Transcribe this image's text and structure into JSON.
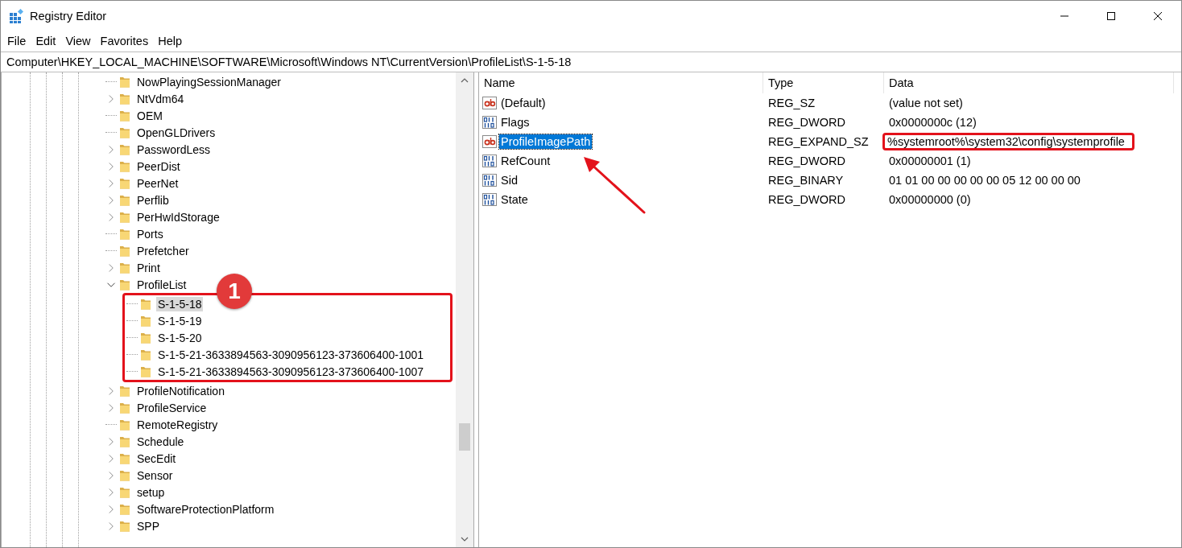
{
  "window": {
    "title": "Registry Editor"
  },
  "menu": [
    "File",
    "Edit",
    "View",
    "Favorites",
    "Help"
  ],
  "address": "Computer\\HKEY_LOCAL_MACHINE\\SOFTWARE\\Microsoft\\Windows NT\\CurrentVersion\\ProfileList\\S-1-5-18",
  "tree": {
    "items": [
      {
        "label": "NowPlayingSessionManager",
        "expandable": false,
        "selected": false
      },
      {
        "label": "NtVdm64",
        "expandable": true,
        "selected": false
      },
      {
        "label": "OEM",
        "expandable": false,
        "selected": false
      },
      {
        "label": "OpenGLDrivers",
        "expandable": false,
        "selected": false
      },
      {
        "label": "PasswordLess",
        "expandable": true,
        "selected": false
      },
      {
        "label": "PeerDist",
        "expandable": true,
        "selected": false
      },
      {
        "label": "PeerNet",
        "expandable": true,
        "selected": false
      },
      {
        "label": "Perflib",
        "expandable": true,
        "selected": false
      },
      {
        "label": "PerHwIdStorage",
        "expandable": true,
        "selected": false
      },
      {
        "label": "Ports",
        "expandable": false,
        "selected": false
      },
      {
        "label": "Prefetcher",
        "expandable": false,
        "selected": false
      },
      {
        "label": "Print",
        "expandable": true,
        "selected": false
      },
      {
        "label": "ProfileList",
        "expandable": true,
        "expanded": true,
        "selected": false,
        "children_highlighted": true,
        "children": [
          {
            "label": "S-1-5-18",
            "expandable": false,
            "selected": true
          },
          {
            "label": "S-1-5-19",
            "expandable": false,
            "selected": false
          },
          {
            "label": "S-1-5-20",
            "expandable": false,
            "selected": false
          },
          {
            "label": "S-1-5-21-3633894563-3090956123-373606400-1001",
            "expandable": false,
            "selected": false
          },
          {
            "label": "S-1-5-21-3633894563-3090956123-373606400-1007",
            "expandable": false,
            "selected": false
          }
        ]
      },
      {
        "label": "ProfileNotification",
        "expandable": true,
        "selected": false
      },
      {
        "label": "ProfileService",
        "expandable": true,
        "selected": false
      },
      {
        "label": "RemoteRegistry",
        "expandable": false,
        "selected": false
      },
      {
        "label": "Schedule",
        "expandable": true,
        "selected": false
      },
      {
        "label": "SecEdit",
        "expandable": true,
        "selected": false
      },
      {
        "label": "Sensor",
        "expandable": true,
        "selected": false
      },
      {
        "label": "setup",
        "expandable": true,
        "selected": false
      },
      {
        "label": "SoftwareProtectionPlatform",
        "expandable": true,
        "selected": false
      },
      {
        "label": "SPP",
        "expandable": true,
        "selected": false
      }
    ]
  },
  "values": {
    "columns": [
      "Name",
      "Type",
      "Data"
    ],
    "rows": [
      {
        "kind": "string",
        "name": "(Default)",
        "type": "REG_SZ",
        "data": "(value not set)",
        "selected": false,
        "data_highlighted": false
      },
      {
        "kind": "binary",
        "name": "Flags",
        "type": "REG_DWORD",
        "data": "0x0000000c (12)",
        "selected": false,
        "data_highlighted": false
      },
      {
        "kind": "string",
        "name": "ProfileImagePath",
        "type": "REG_EXPAND_SZ",
        "data": "%systemroot%\\system32\\config\\systemprofile",
        "selected": true,
        "data_highlighted": true
      },
      {
        "kind": "binary",
        "name": "RefCount",
        "type": "REG_DWORD",
        "data": "0x00000001 (1)",
        "selected": false,
        "data_highlighted": false
      },
      {
        "kind": "binary",
        "name": "Sid",
        "type": "REG_BINARY",
        "data": "01 01 00 00 00 00 00 05 12 00 00 00",
        "selected": false,
        "data_highlighted": false
      },
      {
        "kind": "binary",
        "name": "State",
        "type": "REG_DWORD",
        "data": "0x00000000 (0)",
        "selected": false,
        "data_highlighted": false
      }
    ]
  },
  "annotations": {
    "badge": "1"
  }
}
